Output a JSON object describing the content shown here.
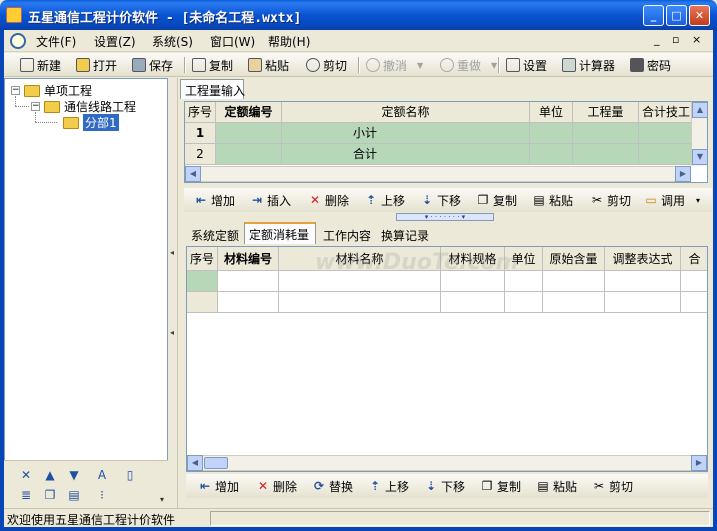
{
  "window": {
    "title": "五星通信工程计价软件 - [未命名工程.wxtx]",
    "minimize_glyph": "_",
    "maximize_glyph": "□",
    "close_glyph": "✕"
  },
  "menu": {
    "items": [
      "文件(F)",
      "设置(Z)",
      "系统(S)",
      "窗口(W)",
      "帮助(H)"
    ],
    "right_controls": [
      "_",
      "▫",
      "×"
    ]
  },
  "toolbar": {
    "new": "新建",
    "open": "打开",
    "save": "保存",
    "copy": "复制",
    "paste": "粘贴",
    "cut": "剪切",
    "undo": "撤消",
    "redo": "重做",
    "settings": "设置",
    "calculator": "计算器",
    "password": "密码"
  },
  "tree": {
    "root": "单项工程",
    "child": "通信线路工程",
    "leaf": "分部1"
  },
  "upper": {
    "tab": "工程量输入",
    "columns": [
      "序号",
      "定额编号",
      "定额名称",
      "单位",
      "工程量",
      "合计技工"
    ],
    "rows": [
      {
        "no": "1",
        "code": "",
        "name": "小计",
        "unit": "",
        "qty": "",
        "total": ""
      },
      {
        "no": "2",
        "code": "",
        "name": "合计",
        "unit": "",
        "qty": "",
        "total": ""
      }
    ]
  },
  "actions1": {
    "add": "增加",
    "insert": "插入",
    "delete": "删除",
    "up": "上移",
    "down": "下移",
    "copy": "复制",
    "paste": "粘贴",
    "cut": "剪切",
    "call": "调用"
  },
  "lower": {
    "tabs": [
      "系统定额",
      "定额消耗量",
      "工作内容",
      "换算记录"
    ],
    "active_tab": 1,
    "columns": [
      "序号",
      "材料编号",
      "材料名称",
      "材料规格",
      "单位",
      "原始含量",
      "调整表达式",
      "合"
    ]
  },
  "actions2": {
    "add": "增加",
    "delete": "删除",
    "replace": "替换",
    "up": "上移",
    "down": "下移",
    "copy": "复制",
    "paste": "粘贴",
    "cut": "剪切"
  },
  "status": {
    "text": "欢迎使用五星通信工程计价软件"
  },
  "watermark": "www.DuoTe.com",
  "colors": {
    "titlebar": "#0a5fd8",
    "grid_green": "#b7d7b9",
    "selection": "#316ac5"
  }
}
